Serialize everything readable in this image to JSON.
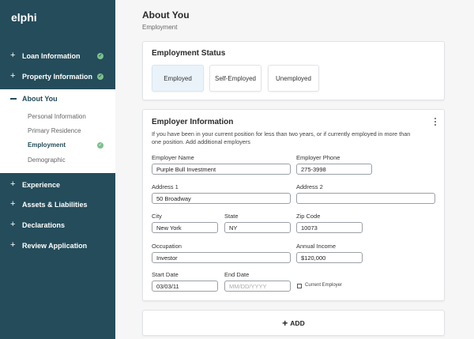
{
  "brand": "elphi",
  "sidebar": {
    "top_items": [
      {
        "label": "Loan Information",
        "icon": "plus-icon",
        "complete": true
      },
      {
        "label": "Property Information",
        "icon": "plus-icon",
        "complete": true
      }
    ],
    "about": {
      "label": "About You",
      "icon": "minus-icon",
      "subitems": [
        {
          "label": "Personal Information",
          "active": false,
          "complete": false
        },
        {
          "label": "Primary Residence",
          "active": false,
          "complete": false
        },
        {
          "label": "Employment",
          "active": true,
          "complete": true
        },
        {
          "label": "Demographic",
          "active": false,
          "complete": false
        }
      ]
    },
    "bottom_items": [
      {
        "label": "Experience",
        "icon": "plus-icon"
      },
      {
        "label": "Assets & Liabilities",
        "icon": "plus-icon"
      },
      {
        "label": "Declarations",
        "icon": "plus-icon"
      },
      {
        "label": "Review Application",
        "icon": "plus-icon"
      }
    ]
  },
  "header": {
    "title": "About You",
    "subtitle": "Employment"
  },
  "employment_status": {
    "title": "Employment Status",
    "options": [
      "Employed",
      "Self-Employed",
      "Unemployed"
    ],
    "selected": "Employed"
  },
  "employer": {
    "title": "Employer Information",
    "description": "If you have been in your current position for less than two years, or if currently employed in more than one position. Add additional employers",
    "fields": {
      "employer_name": {
        "label": "Employer Name",
        "value": "Purple Bull Investment"
      },
      "employer_phone": {
        "label": "Employer Phone",
        "value": "275-3998"
      },
      "address1": {
        "label": "Address 1",
        "value": "50 Broadway"
      },
      "address2": {
        "label": "Address 2",
        "value": ""
      },
      "city": {
        "label": "City",
        "value": "New York"
      },
      "state": {
        "label": "State",
        "value": "NY"
      },
      "zip": {
        "label": "Zip Code",
        "value": "10073"
      },
      "occupation": {
        "label": "Occupation",
        "value": "Investor"
      },
      "annual_income": {
        "label": "Annual Income",
        "value": "$120,000"
      },
      "start_date": {
        "label": "Start Date",
        "value": "03/03/11"
      },
      "end_date": {
        "label": "End Date",
        "value": "",
        "placeholder": "MM/DD/YYYY"
      }
    },
    "current_employer_label": "Current Employer",
    "current_employer_checked": false
  },
  "add_button": {
    "icon": "plus-icon",
    "label": "ADD"
  },
  "colors": {
    "sidebar": "#244c5a",
    "check": "#7cc18e",
    "selected_option": "#eaf3fa"
  }
}
